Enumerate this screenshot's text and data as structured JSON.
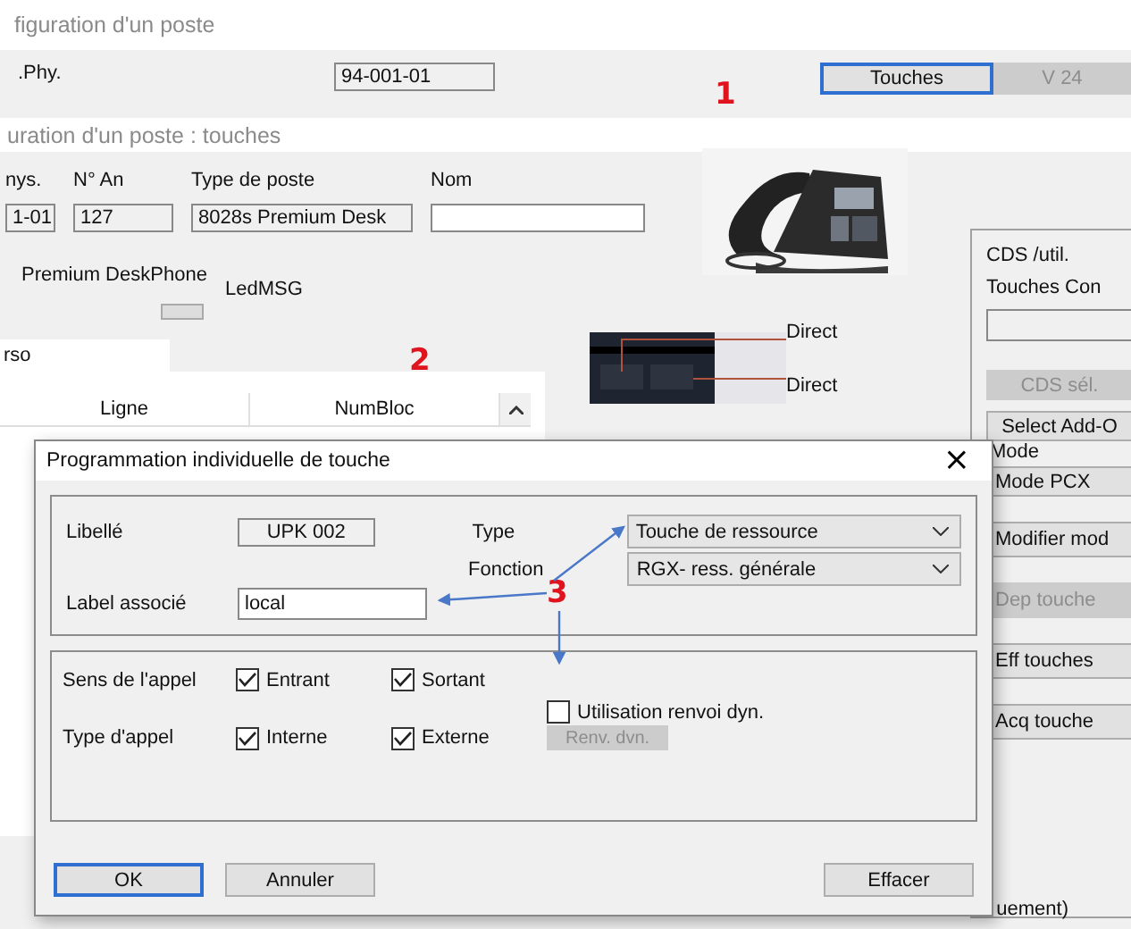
{
  "back_window": {
    "title": "figuration d'un poste",
    "label": ".Phy.",
    "field_value": "94-001-01",
    "annotation": "1",
    "buttons": [
      {
        "label": "Touches",
        "disabled": false,
        "focused": true
      },
      {
        "label": "V 24",
        "disabled": true,
        "focused": false
      }
    ]
  },
  "main_window": {
    "title": "uration d'un poste : touches",
    "fields": [
      {
        "label": "nys.",
        "value": "1-01"
      },
      {
        "label": "N° An",
        "value": "127"
      },
      {
        "label": "Type de poste",
        "value": "8028s Premium Desk"
      },
      {
        "label": "Nom"
      }
    ],
    "phone_model": "Premium DeskPhone",
    "led_label": "LedMSG",
    "tabs": [
      {
        "label": "rso",
        "selected": true
      }
    ],
    "table": {
      "columns": [
        "Ligne",
        "NumBloc"
      ]
    },
    "annotation": "2",
    "key_labels": [
      "Direct",
      "Direct"
    ],
    "right_panel": {
      "title": "CDS  /util.",
      "subtitle": "Touches Con",
      "mode_label": "Mode",
      "items": [
        {
          "kind": "field"
        },
        {
          "kind": "button",
          "label": "CDS sél.",
          "disabled": true
        },
        {
          "kind": "button",
          "label": "Select Add-O",
          "disabled": false
        },
        {
          "kind": "button",
          "label": "Mode PCX",
          "disabled": false
        },
        {
          "kind": "button",
          "label": "Modifier mod",
          "disabled": false
        },
        {
          "kind": "button",
          "label": "Dep touche",
          "disabled": true
        },
        {
          "kind": "button",
          "label": "Eff touches",
          "disabled": false
        },
        {
          "kind": "button",
          "label": "Acq touche",
          "disabled": false
        }
      ]
    },
    "footer_text": "uement)"
  },
  "dialog": {
    "title": "Programmation individuelle de touche",
    "close": "×",
    "libelle": {
      "label": "Libellé",
      "value": "UPK 002"
    },
    "type": {
      "label": "Type",
      "value": "Touche de ressource"
    },
    "fonction": {
      "label": "Fonction",
      "value": "RGX- ress. générale"
    },
    "label_associe": {
      "label": "Label associé",
      "value": "local"
    },
    "annotation": "3",
    "sens": {
      "label": "Sens de l'appel",
      "options": [
        {
          "label": "Entrant",
          "checked": true
        },
        {
          "label": "Sortant",
          "checked": true
        }
      ]
    },
    "renvoi": {
      "label": "Utilisation renvoi dyn.",
      "checked": false
    },
    "type_appel": {
      "label": "Type d'appel",
      "options": [
        {
          "label": "Interne",
          "checked": true
        },
        {
          "label": "Externe",
          "checked": true
        }
      ]
    },
    "renv_button": {
      "label": "Renv. dvn.",
      "disabled": true
    },
    "buttons": [
      {
        "label": "OK",
        "default": true
      },
      {
        "label": "Annuler",
        "default": false
      },
      {
        "label": "Effacer",
        "default": false
      }
    ]
  }
}
